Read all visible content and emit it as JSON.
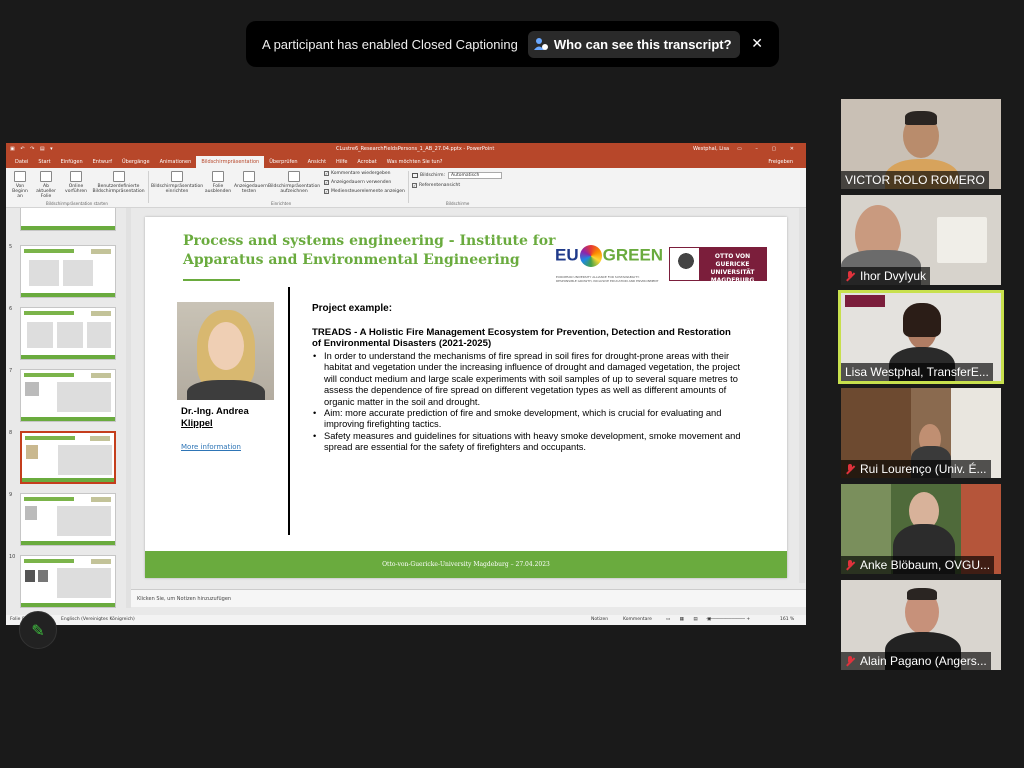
{
  "notification": {
    "message": "A participant has enabled Closed Captioning",
    "button_label": "Who can see this transcript?",
    "close_symbol": "✕"
  },
  "powerpoint": {
    "title": "CLustre6_ResearchFieldsPersons_1_AB_27.04.pptx  -  PowerPoint",
    "user": "Westphal, Lisa",
    "tabs": [
      "Datei",
      "Start",
      "Einfügen",
      "Entwurf",
      "Übergänge",
      "Animationen",
      "Bildschirmpräsentation",
      "Überprüfen",
      "Ansicht",
      "Hilfe",
      "Acrobat",
      "Was möchten Sie tun?"
    ],
    "active_tab": "Bildschirmpräsentation",
    "share_label": "Freigeben",
    "ribbon": {
      "btn_from_start": "Von Beginn an",
      "btn_from_current": "Ab aktueller Folie",
      "btn_online": "Online vorführen",
      "btn_custom": "Benutzerdefinierte Bildschirmpräsentation",
      "group_start": "Bildschirmpräsentation starten",
      "btn_setup": "Bildschirmpräsentation einrichten",
      "btn_hide": "Folie ausblenden",
      "btn_rehearse": "Anzeigedauern testen",
      "btn_record": "Bildschirmpräsentation aufzeichnen",
      "group_setup": "Einrichten",
      "chk_comments": "Kommentare wiedergeben",
      "chk_timings": "Anzeigedauern verwenden",
      "chk_media": "Mediensteuerelemente anzeigen",
      "monitor_label": "Bildschirm:",
      "monitor_value": "Automatisch",
      "chk_presenter": "Referentenansicht",
      "group_monitors": "Bildschirme"
    },
    "thumbnails": [
      "5",
      "6",
      "7",
      "8",
      "9",
      "10"
    ],
    "selected_slide": "8",
    "notes_placeholder": "Klicken Sie, um Notizen hinzuzufügen",
    "status": {
      "slide": "Folie 8 von 13",
      "language": "Englisch (Vereinigtes Königreich)",
      "notes": "Notizen",
      "comments": "Kommentare",
      "zoom": "161 %"
    }
  },
  "slide": {
    "title": "Process and systems engineering - Institute for Apparatus and Environmental Engineering",
    "eu_green": "EU",
    "green": "GREEN",
    "eu_sub": "EUROPEAN UNIVERSITY ALLIANCE FOR SUSTAINABILITY: RESPONSIBLE GROWTH, INCLUSIVE EDUCATION AND ENVIRONMENT",
    "ogu": "OTTO VON GUERICKE UNIVERSITÄT MAGDEBURG",
    "person_name_1": "Dr.-Ing. Andrea",
    "person_name_2": "Klippel",
    "more_info": "More information",
    "project_label": "Project example:",
    "project_title": "TREADS - A Holistic Fire Management Ecosystem for Prevention, Detection and Restoration of Environmental Disasters (2021-2025)",
    "bullets": [
      "In order to understand the mechanisms of fire spread in soil fires for drought-prone areas with their habitat and vegetation under the increasing influence of drought and damaged vegetation, the project will conduct medium and large scale experiments with soil samples of up to several square metres to assess the dependence of fire spread on different vegetation types as well as different amounts of organic matter in the soil and drought.",
      "Aim: more accurate prediction of fire and smoke development, which is crucial for evaluating and improving firefighting tactics.",
      "Safety measures and guidelines for situations with heavy smoke development, smoke movement and spread are essential for the safety of firefighters and occupants."
    ],
    "footer": "Otto-von-Guericke-University Magdeburg – 27.04.2023"
  },
  "participants": [
    {
      "name": "VICTOR ROLO ROMERO",
      "muted": false,
      "active": false
    },
    {
      "name": "Ihor Dvylyuk",
      "muted": true,
      "active": false
    },
    {
      "name": "Lisa Westphal, TransferE...",
      "muted": false,
      "active": true
    },
    {
      "name": "Rui Lourenço (Univ. É...",
      "muted": true,
      "active": false
    },
    {
      "name": "Anke Blöbaum, OVGU...",
      "muted": true,
      "active": false
    },
    {
      "name": "Alain Pagano (Angers...",
      "muted": true,
      "active": false
    }
  ],
  "colors": {
    "ppt_accent": "#b7472a",
    "slide_green": "#6aab3e",
    "ovgu_red": "#7b1e3b",
    "active_speaker": "#c8e04d"
  }
}
